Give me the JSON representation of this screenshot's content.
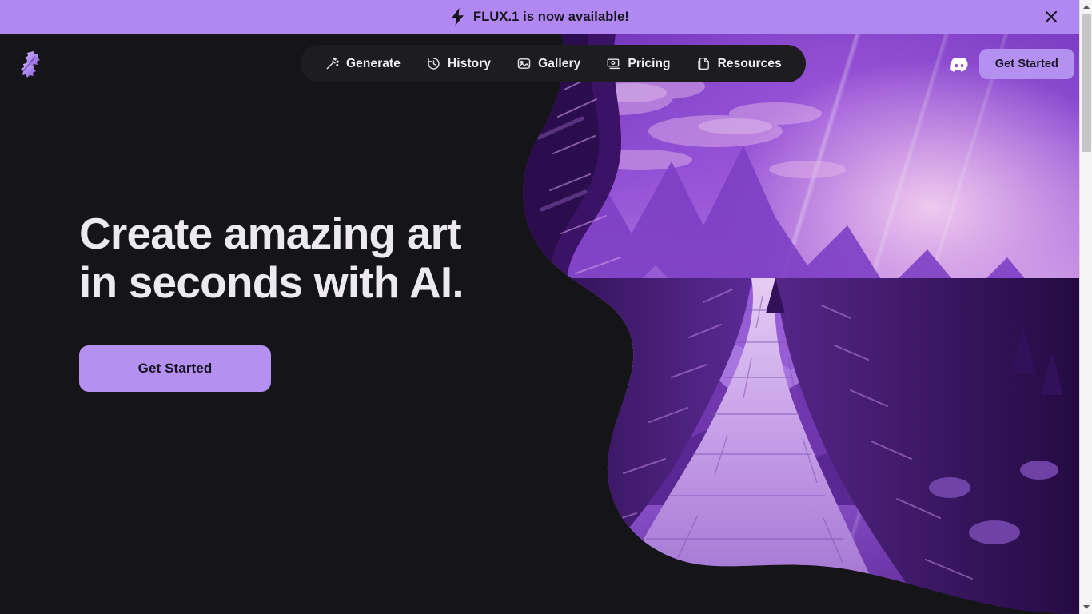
{
  "banner": {
    "icon": "lightning-bolt-icon",
    "text": "FLUX.1 is now available!",
    "close_label": "×",
    "background_color": "#b188f2",
    "text_color": "#17131f"
  },
  "header": {
    "logo_name": "brand-logo-icon",
    "nav": {
      "items": [
        {
          "label": "Generate",
          "icon": "magic-wand-icon"
        },
        {
          "label": "History",
          "icon": "clock-history-icon"
        },
        {
          "label": "Gallery",
          "icon": "image-icon"
        },
        {
          "label": "Pricing",
          "icon": "payment-card-icon"
        },
        {
          "label": "Resources",
          "icon": "document-icon"
        }
      ],
      "background_color": "#1c1c21"
    },
    "discord_label": "discord-icon",
    "cta_label": "Get Started"
  },
  "hero": {
    "title_line1": "Create amazing art",
    "title_line2": "in seconds with AI.",
    "cta_label": "Get Started",
    "accent_color": "#b491f0",
    "background_color": "#151519",
    "title_color": "#eceaf0",
    "media_alt": "purple-mountain-landscape-illustration"
  },
  "scrollbar": {
    "up_arrow": "scroll-up-arrow-icon",
    "down_arrow": "scroll-down-arrow-icon",
    "thumb": "scrollbar-thumb"
  }
}
